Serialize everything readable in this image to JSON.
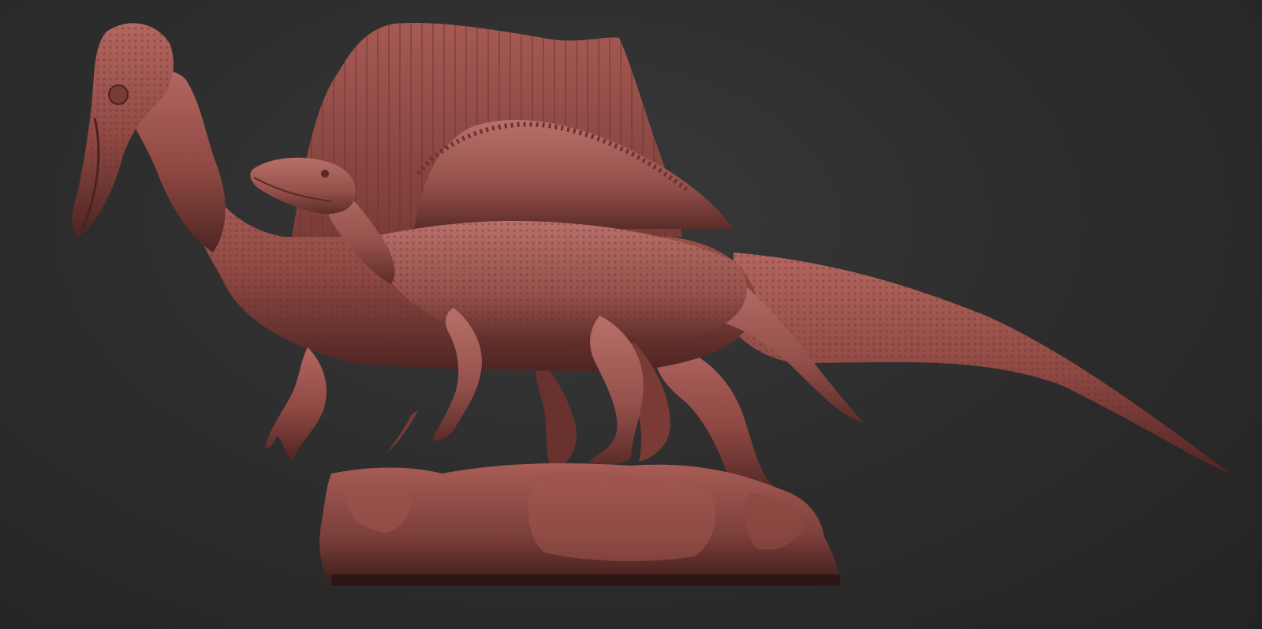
{
  "scene": {
    "subject": "sculpt-spinosaurus-pair",
    "colors": {
      "background": "#2e2e2e",
      "clay_light": "#b0605a",
      "clay_mid": "#8c4640",
      "clay_dark": "#5a2a26",
      "clay_shadow": "#3a1c1a"
    }
  }
}
